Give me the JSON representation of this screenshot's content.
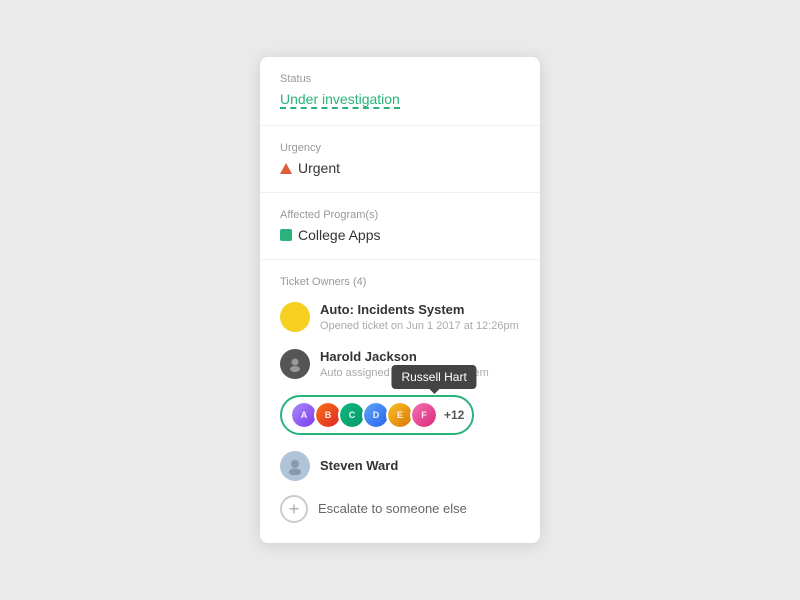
{
  "card": {
    "status": {
      "label": "Status",
      "value": "Under investigation"
    },
    "urgency": {
      "label": "Urgency",
      "value": "Urgent"
    },
    "affected_programs": {
      "label": "Affected Program(s)",
      "value": "College Apps"
    },
    "ticket_owners": {
      "label": "Ticket Owners (4)",
      "owners": [
        {
          "name": "Auto: Incidents System",
          "sub": "Opened ticket on Jun 1 2017 at 12:26pm",
          "avatar_type": "yellow"
        },
        {
          "name": "Harold Jackson",
          "sub": "Auto assigned by incidents system",
          "avatar_type": "dark"
        }
      ],
      "avatar_group": {
        "count_label": "+12",
        "tooltip": "Russell Hart"
      },
      "steven": {
        "name": "Steven Ward"
      },
      "escalate": {
        "label": "Escalate to someone else"
      }
    }
  }
}
